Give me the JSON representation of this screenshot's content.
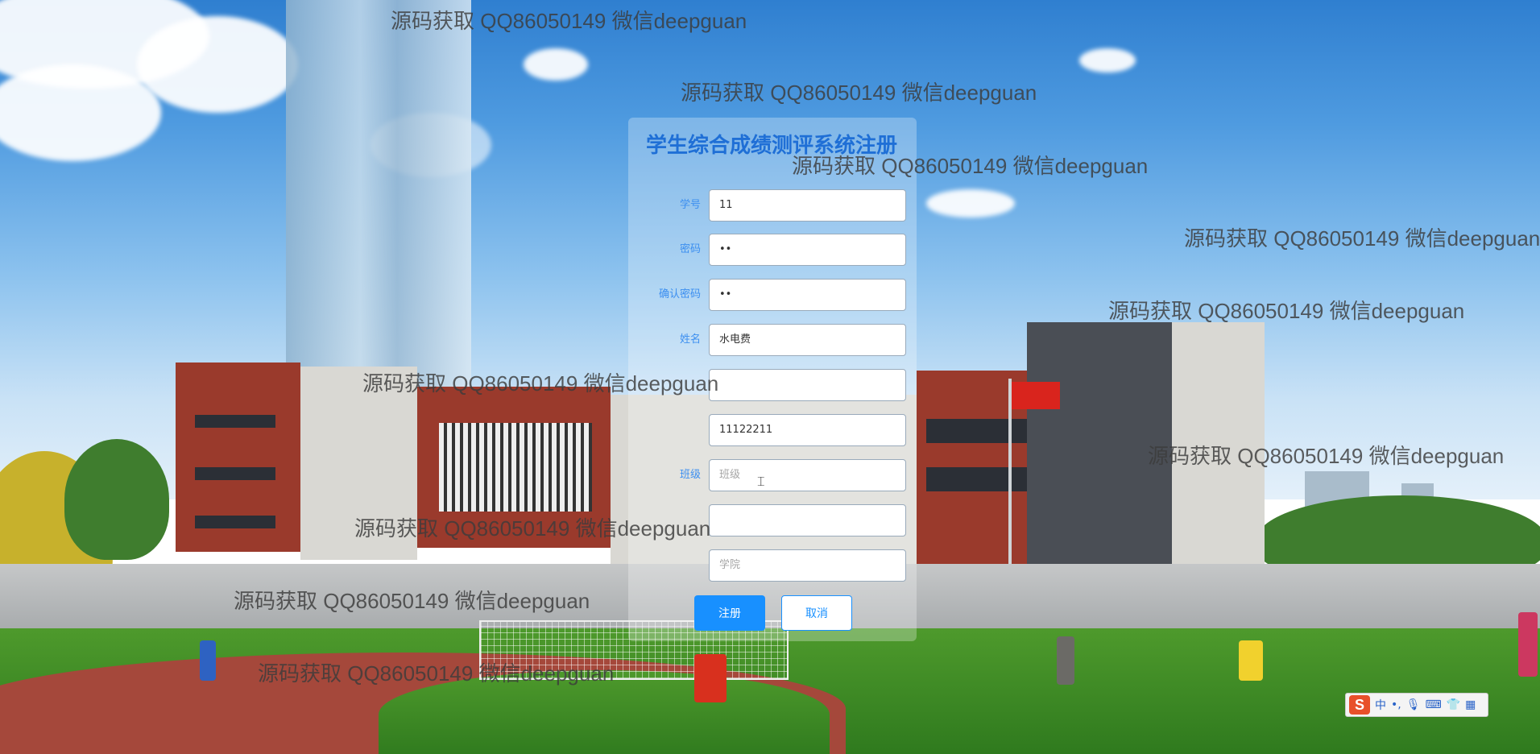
{
  "watermark": "源码获取 QQ86050149 微信deepguan",
  "form": {
    "title": "学生综合成绩测评系统注册",
    "fields": [
      {
        "label": "学号",
        "value": "11",
        "placeholder": ""
      },
      {
        "label": "密码",
        "value": "••",
        "placeholder": ""
      },
      {
        "label": "确认密码",
        "value": "••",
        "placeholder": ""
      },
      {
        "label": "姓名",
        "value": "水电费",
        "placeholder": ""
      },
      {
        "label": "",
        "value": "",
        "placeholder": ""
      },
      {
        "label": "",
        "value": "11122211",
        "placeholder": ""
      },
      {
        "label": "班级",
        "value": "",
        "placeholder": "班级"
      },
      {
        "label": "",
        "value": "",
        "placeholder": ""
      },
      {
        "label": "",
        "value": "",
        "placeholder": "学院"
      }
    ],
    "submit_label": "注册",
    "cancel_label": "取消"
  },
  "ime": {
    "logo": "S",
    "mode": "中",
    "icons": [
      "punctuation-icon",
      "microphone-icon",
      "keyboard-icon",
      "skin-icon",
      "toolbox-icon"
    ]
  }
}
